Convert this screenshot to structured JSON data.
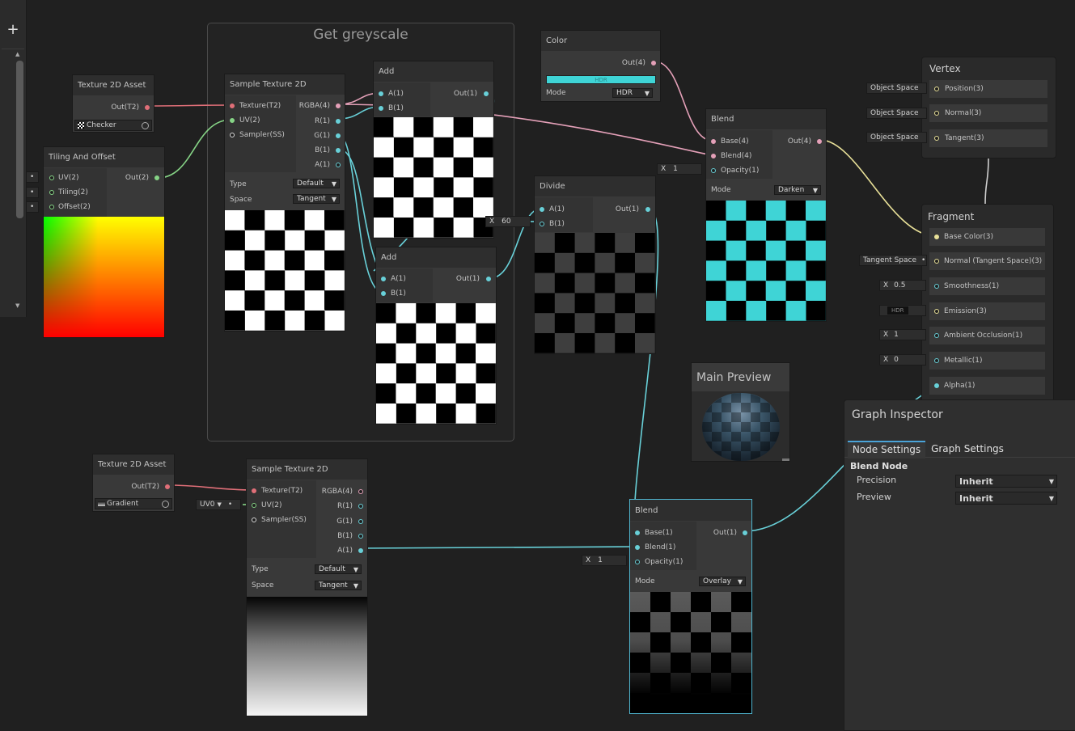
{
  "colors": {
    "pink": "#e4a0b8",
    "red": "#e06060",
    "green": "#7cd07c",
    "cyan": "#68d0d8",
    "yellow": "#e8e098",
    "teal": "#3fd4d6"
  },
  "toolbar": {
    "add_label": "+"
  },
  "group": {
    "title": "Get greyscale"
  },
  "tex_asset_1": {
    "title": "Texture 2D Asset",
    "out": "Out(T2)",
    "value": "Checker"
  },
  "tex_asset_2": {
    "title": "Texture 2D Asset",
    "out": "Out(T2)",
    "value": "Gradient"
  },
  "tiling": {
    "title": "Tiling And Offset",
    "inputs": [
      "UV(2)",
      "Tiling(2)",
      "Offset(2)"
    ],
    "out": "Out(2)"
  },
  "sample1": {
    "title": "Sample Texture 2D",
    "inputs": [
      "Texture(T2)",
      "UV(2)",
      "Sampler(SS)"
    ],
    "outputs": [
      "RGBA(4)",
      "R(1)",
      "G(1)",
      "B(1)",
      "A(1)"
    ],
    "type_label": "Type",
    "type_value": "Default",
    "space_label": "Space",
    "space_value": "Tangent"
  },
  "sample2": {
    "title": "Sample Texture 2D",
    "inputs": [
      "Texture(T2)",
      "UV(2)",
      "Sampler(SS)"
    ],
    "outputs": [
      "RGBA(4)",
      "R(1)",
      "G(1)",
      "B(1)",
      "A(1)"
    ],
    "type_label": "Type",
    "type_value": "Default",
    "space_label": "Space",
    "space_value": "Tangent",
    "uv_chip": "UV0"
  },
  "add1": {
    "title": "Add",
    "inputs": [
      "A(1)",
      "B(1)"
    ],
    "out": "Out(1)"
  },
  "add2": {
    "title": "Add",
    "inputs": [
      "A(1)",
      "B(1)"
    ],
    "out": "Out(1)"
  },
  "color": {
    "title": "Color",
    "out": "Out(4)",
    "swatch_label": "HDR",
    "mode_label": "Mode",
    "mode_value": "HDR"
  },
  "divide": {
    "title": "Divide",
    "inputs": [
      "A(1)",
      "B(1)"
    ],
    "out": "Out(1)",
    "b_chip_x": "X",
    "b_chip_value": "60"
  },
  "blend1": {
    "title": "Blend",
    "inputs": [
      "Base(4)",
      "Blend(4)",
      "Opacity(1)"
    ],
    "out": "Out(4)",
    "mode_label": "Mode",
    "mode_value": "Darken",
    "opacity_x": "X",
    "opacity_value": "1"
  },
  "blend2": {
    "title": "Blend",
    "inputs": [
      "Base(1)",
      "Blend(1)",
      "Opacity(1)"
    ],
    "out": "Out(1)",
    "mode_label": "Mode",
    "mode_value": "Overlay",
    "opacity_x": "X",
    "opacity_value": "1"
  },
  "vertex": {
    "title": "Vertex",
    "ports": [
      "Position(3)",
      "Normal(3)",
      "Tangent(3)"
    ],
    "chips": [
      "Object Space",
      "Object Space",
      "Object Space"
    ]
  },
  "fragment": {
    "title": "Fragment",
    "ports": [
      "Base Color(3)",
      "Normal (Tangent Space)(3)",
      "Smoothness(1)",
      "Emission(3)",
      "Ambient Occlusion(1)",
      "Metallic(1)",
      "Alpha(1)"
    ],
    "normal_chip": "Tangent Space",
    "smooth_x": "X",
    "smooth_value": "0.5",
    "emission_chip": "HDR",
    "ao_x": "X",
    "ao_value": "1",
    "metal_x": "X",
    "metal_value": "0"
  },
  "main_preview": {
    "title": "Main Preview"
  },
  "inspector": {
    "title": "Graph Inspector",
    "tabs": [
      "Node Settings",
      "Graph Settings"
    ],
    "section": "Blend Node",
    "rows": [
      {
        "label": "Precision",
        "value": "Inherit"
      },
      {
        "label": "Preview",
        "value": "Inherit"
      }
    ]
  }
}
